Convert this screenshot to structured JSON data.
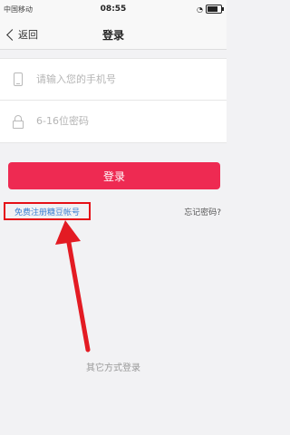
{
  "status_bar": {
    "carrier": "中国移动",
    "time": "08:55",
    "icons": [
      "signal-icon",
      "wifi-icon",
      "alarm-icon",
      "battery-icon"
    ]
  },
  "nav": {
    "back_label": "返回",
    "title": "登录"
  },
  "form": {
    "phone_placeholder": "请输入您的手机号",
    "password_placeholder": "6-16位密码",
    "phone_value": "",
    "password_value": ""
  },
  "actions": {
    "login_label": "登录",
    "register_label": "免费注册糖豆帐号",
    "forgot_label": "忘记密码?"
  },
  "footer": {
    "other_login_label": "其它方式登录"
  },
  "colors": {
    "accent": "#ee2a52",
    "highlight_box": "#e50f17",
    "link": "#3a7ed1",
    "annotation_arrow": "#e31b23"
  }
}
